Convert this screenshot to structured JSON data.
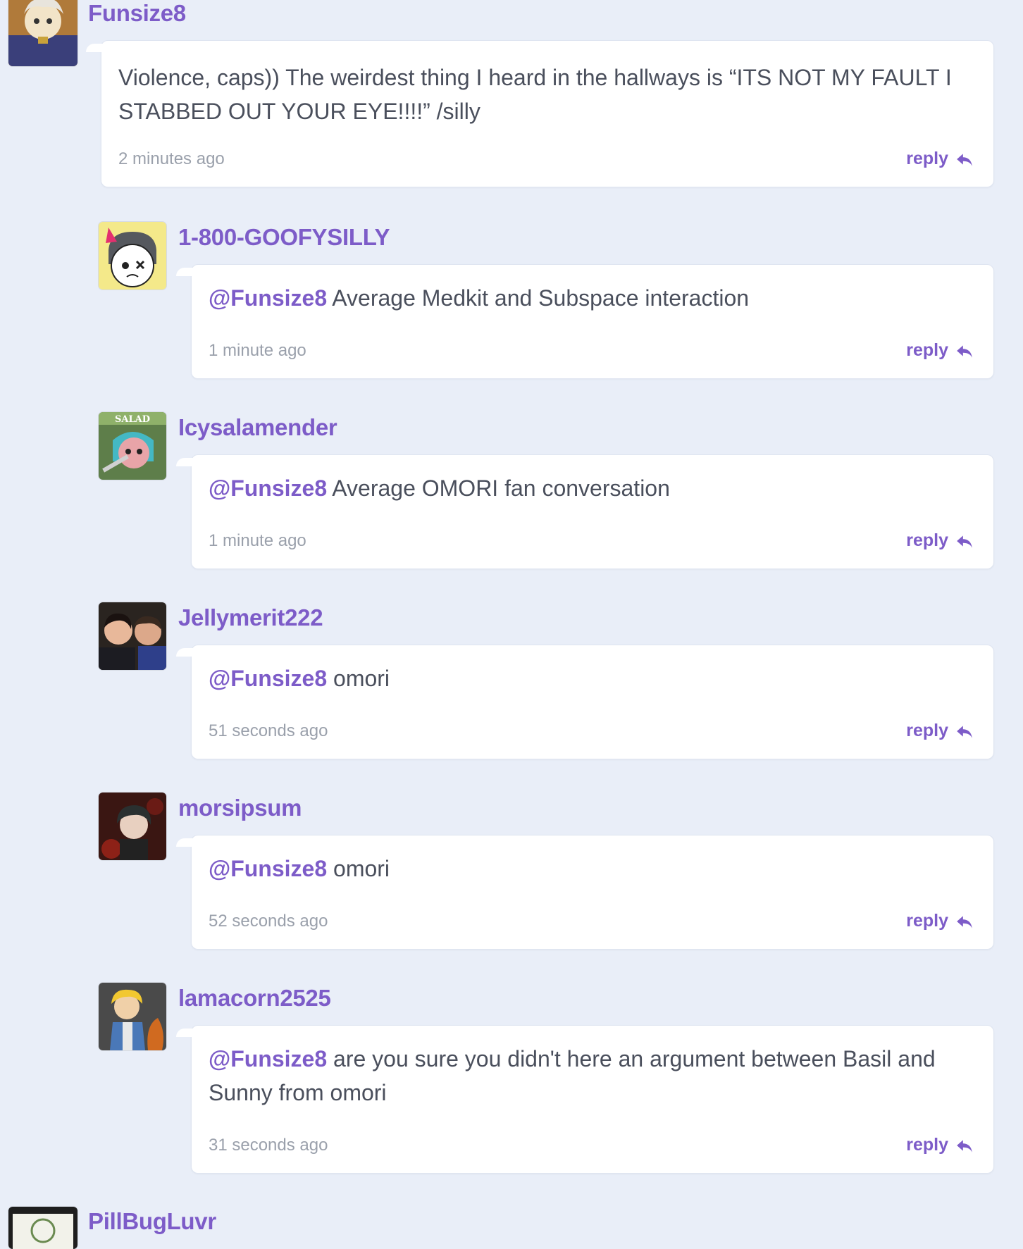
{
  "comments": [
    {
      "username": "Funsize8",
      "mention": "",
      "text": "Violence, caps)) The weirdest thing I heard in the hallways is “ITS NOT MY FAULT I STABBED OUT YOUR EYE!!!!” /silly",
      "time": "2 minutes ago",
      "reply_label": "reply",
      "avatar_icon": "avatar-image"
    },
    {
      "username": "1-800-GOOFYSILLY",
      "mention": "@Funsize8",
      "text": "Average Medkit and Subspace interaction",
      "time": "1 minute ago",
      "reply_label": "reply",
      "avatar_icon": "avatar-image"
    },
    {
      "username": "Icysalamender",
      "mention": "@Funsize8",
      "text": "Average OMORI fan conversation",
      "time": "1 minute ago",
      "reply_label": "reply",
      "avatar_icon": "avatar-image",
      "avatar_text": "SALAD"
    },
    {
      "username": "Jellymerit222",
      "mention": "@Funsize8",
      "text": "omori",
      "time": "51 seconds ago",
      "reply_label": "reply",
      "avatar_icon": "avatar-image"
    },
    {
      "username": "morsipsum",
      "mention": "@Funsize8",
      "text": "omori",
      "time": "52 seconds ago",
      "reply_label": "reply",
      "avatar_icon": "avatar-image"
    },
    {
      "username": "lamacorn2525",
      "mention": "@Funsize8",
      "text": "are you sure you didn't here an argument between Basil and Sunny from omori",
      "time": "31 seconds ago",
      "reply_label": "reply",
      "avatar_icon": "avatar-image"
    },
    {
      "username": "PillBugLuvr",
      "avatar_icon": "avatar-image"
    }
  ],
  "colors": {
    "background": "#e9eef8",
    "accent": "#7d5cc8",
    "text": "#4a4f5c",
    "muted": "#9aa0ab"
  }
}
